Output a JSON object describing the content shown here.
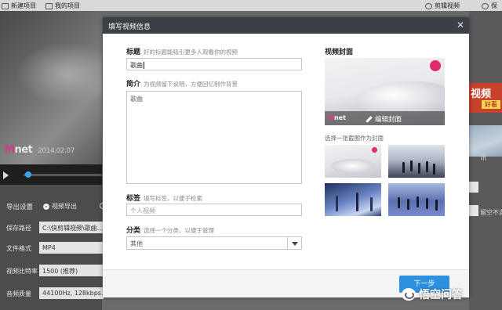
{
  "app": {
    "new_project": "新建项目",
    "my_projects": "我的项目",
    "cut_video": "剪辑视频",
    "save": "保"
  },
  "background_video": {
    "logo_m": "M",
    "logo_net": "net",
    "date": "2014.02.07"
  },
  "export": {
    "settings_label": "导出设置",
    "video_export": "视频导出",
    "rows": [
      {
        "label": "保存路径",
        "value": "C:\\快剪辑视频\\歌曲..."
      },
      {
        "label": "文件格式",
        "value": "MP4"
      },
      {
        "label": "视频比特率",
        "value": "1500 (推荐)"
      },
      {
        "label": "音频质量",
        "value": "44100Hz, 128kbps..."
      }
    ]
  },
  "right_panel": {
    "ad_title": "视频",
    "ad_sub": "好看",
    "side_text": "留空不满",
    "side_text2": "讯"
  },
  "modal": {
    "title": "填写视频信息",
    "title_label": "标题",
    "title_hint": "好的标题能吸引更多人观看你的视频",
    "title_value": "歌曲",
    "desc_label": "简介",
    "desc_hint": "为视频留下说明，方便回忆制作背景",
    "desc_value": "歌曲",
    "tags_label": "标签",
    "tags_hint": "填写标签，以便于检索",
    "tags_placeholder": "个人视频",
    "category_label": "分类",
    "category_hint": "选择一个分类，以便于管理",
    "category_value": "其他",
    "cover_label": "视频封面",
    "cover_logo_m": "M",
    "cover_logo_net": "net",
    "edit_cover": "编辑封面",
    "choose_cover_hint": "选择一张截图作为封面",
    "next_button": "下一步"
  },
  "watermark": {
    "text": "悟空问答"
  },
  "colors": {
    "header_bg": "#3b3f46",
    "primary_button": "#2d8fe0",
    "mnet_pink": "#e02b6e"
  }
}
